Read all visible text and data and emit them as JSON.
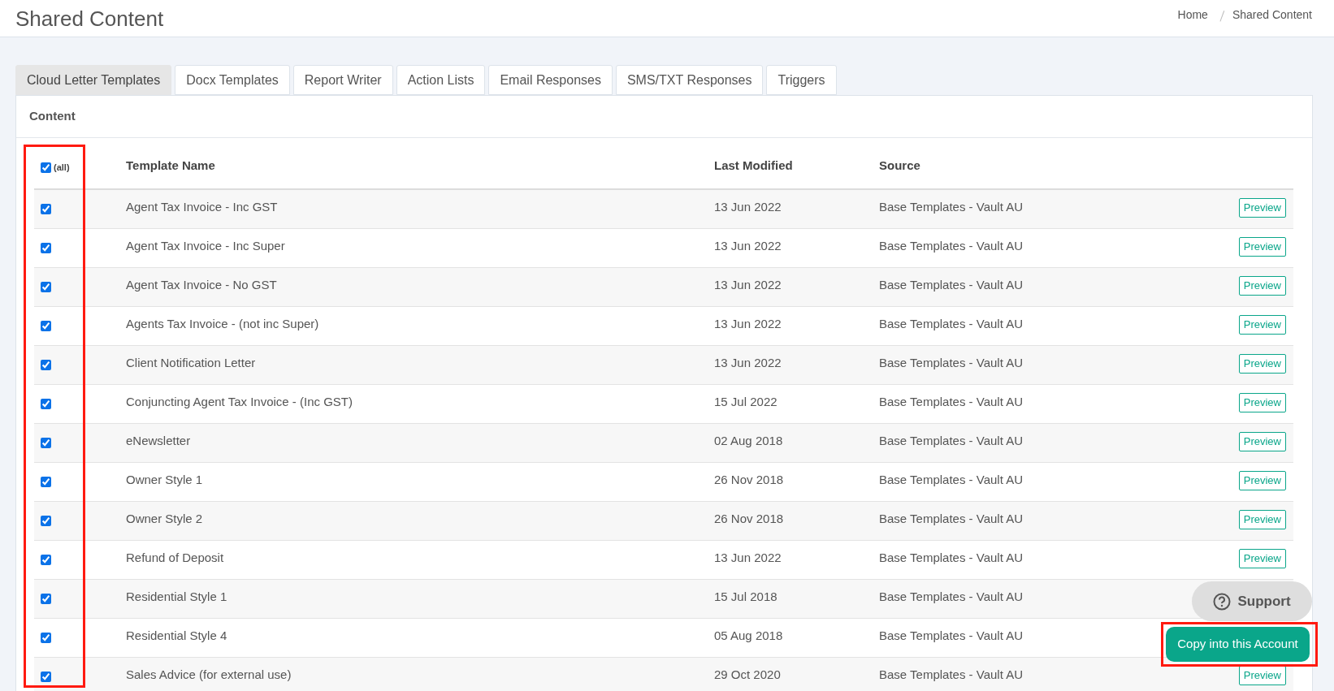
{
  "page_title": "Shared Content",
  "breadcrumb": [
    "Home",
    "Shared Content"
  ],
  "tabs": [
    {
      "label": "Cloud Letter Templates",
      "selected": true
    },
    {
      "label": "Docx Templates",
      "selected": false
    },
    {
      "label": "Report Writer",
      "selected": false
    },
    {
      "label": "Action Lists",
      "selected": false
    },
    {
      "label": "Email Responses",
      "selected": false
    },
    {
      "label": "SMS/TXT Responses",
      "selected": false
    },
    {
      "label": "Triggers",
      "selected": false
    }
  ],
  "panel_title": "Content",
  "table": {
    "select_all": {
      "label": "(all)",
      "checked": true
    },
    "columns": [
      "Template Name",
      "Last Modified",
      "Source"
    ],
    "rows": [
      {
        "checked": true,
        "name": "Agent Tax Invoice - Inc GST",
        "modified": "13 Jun 2022",
        "source": "Base Templates - Vault AU",
        "preview": "Preview"
      },
      {
        "checked": true,
        "name": "Agent Tax Invoice - Inc Super",
        "modified": "13 Jun 2022",
        "source": "Base Templates - Vault AU",
        "preview": "Preview"
      },
      {
        "checked": true,
        "name": "Agent Tax Invoice - No GST",
        "modified": "13 Jun 2022",
        "source": "Base Templates - Vault AU",
        "preview": "Preview"
      },
      {
        "checked": true,
        "name": "Agents Tax Invoice - (not inc Super)",
        "modified": "13 Jun 2022",
        "source": "Base Templates - Vault AU",
        "preview": "Preview"
      },
      {
        "checked": true,
        "name": "Client Notification Letter",
        "modified": "13 Jun 2022",
        "source": "Base Templates - Vault AU",
        "preview": "Preview"
      },
      {
        "checked": true,
        "name": "Conjuncting Agent Tax Invoice - (Inc GST)",
        "modified": "15 Jul 2022",
        "source": "Base Templates - Vault AU",
        "preview": "Preview"
      },
      {
        "checked": true,
        "name": "eNewsletter",
        "modified": "02 Aug 2018",
        "source": "Base Templates - Vault AU",
        "preview": "Preview"
      },
      {
        "checked": true,
        "name": "Owner Style 1",
        "modified": "26 Nov 2018",
        "source": "Base Templates - Vault AU",
        "preview": "Preview"
      },
      {
        "checked": true,
        "name": "Owner Style 2",
        "modified": "26 Nov 2018",
        "source": "Base Templates - Vault AU",
        "preview": "Preview"
      },
      {
        "checked": true,
        "name": "Refund of Deposit",
        "modified": "13 Jun 2022",
        "source": "Base Templates - Vault AU",
        "preview": "Preview"
      },
      {
        "checked": true,
        "name": "Residential Style 1",
        "modified": "15 Jul 2018",
        "source": "Base Templates - Vault AU"
      },
      {
        "checked": true,
        "name": "Residential Style 4",
        "modified": "05 Aug 2018",
        "source": "Base Templates - Vault AU"
      },
      {
        "checked": true,
        "name": "Sales Advice (for external use)",
        "modified": "29 Oct 2020",
        "source": "Base Templates - Vault AU",
        "preview": "Preview"
      }
    ]
  },
  "support_button": "Support",
  "copy_button": "Copy into this Account"
}
